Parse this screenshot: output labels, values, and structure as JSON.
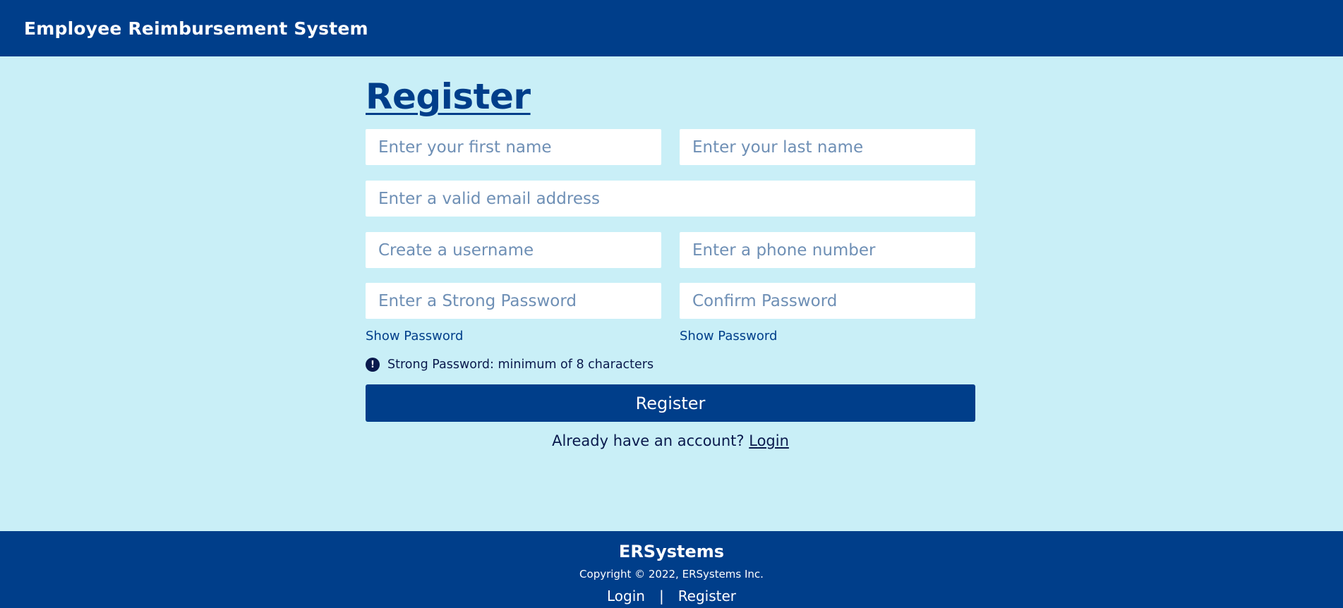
{
  "header": {
    "title": "Employee Reimbursement System"
  },
  "form": {
    "title": "Register",
    "first_name_placeholder": "Enter your first name",
    "last_name_placeholder": "Enter your last name",
    "email_placeholder": "Enter a valid email address",
    "username_placeholder": "Create a username",
    "phone_placeholder": "Enter a phone number",
    "password_placeholder": "Enter a Strong Password",
    "confirm_placeholder": "Confirm Password",
    "show_password_label": "Show Password",
    "show_confirm_label": "Show Password",
    "hint_icon": "exclamation-circle-icon",
    "hint_text": "Strong Password: minimum of 8 characters",
    "submit_label": "Register",
    "already_text": "Already have an account?",
    "login_link": "Login"
  },
  "footer": {
    "brand": "ERSystems",
    "copyright": "Copyright © 2022, ERSystems Inc.",
    "links": [
      "Login",
      "Register"
    ],
    "separator": "|"
  },
  "colors": {
    "primary": "#003e8a",
    "background": "#c9eff7",
    "text_dark": "#0a1a4d",
    "placeholder": "#6e8fb5"
  }
}
